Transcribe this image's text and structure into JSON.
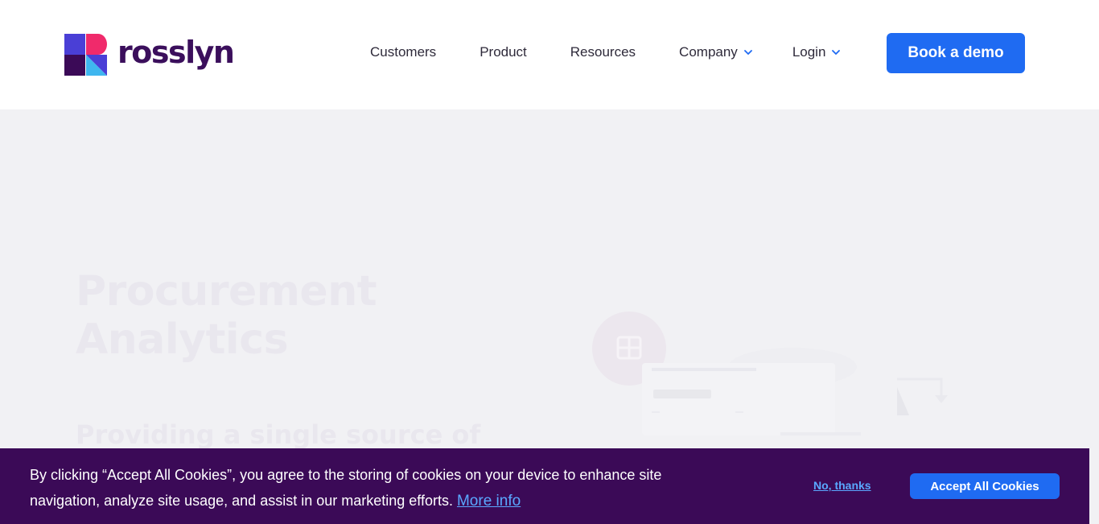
{
  "brand": {
    "name": "rosslyn",
    "colors": {
      "logo_blue": "#4a3fd6",
      "logo_pink": "#f02a6b",
      "logo_dark": "#3b0a57",
      "logo_cyan": "#3fb6ef",
      "accent": "#1f6bf2",
      "banner": "#3b0a57"
    }
  },
  "nav": {
    "items": [
      {
        "label": "Customers",
        "has_dropdown": false
      },
      {
        "label": "Product",
        "has_dropdown": false
      },
      {
        "label": "Resources",
        "has_dropdown": false
      },
      {
        "label": "Company",
        "has_dropdown": true
      },
      {
        "label": "Login",
        "has_dropdown": true
      }
    ],
    "cta_label": "Book a demo"
  },
  "hero": {
    "title_line1": "Procurement",
    "title_line2": "Analytics",
    "subtitle": "Providing a single source of"
  },
  "cookie_banner": {
    "text": "By clicking “Accept All Cookies”, you agree to the storing of cookies on your device to enhance site navigation, analyze site usage, and assist in our marketing efforts.",
    "more_info_label": "More info",
    "decline_label": "No, thanks",
    "accept_label": "Accept All Cookies"
  },
  "icons": {
    "dropdown": "chevron-down-icon",
    "illustration": "dashboard-preview-illustration"
  }
}
